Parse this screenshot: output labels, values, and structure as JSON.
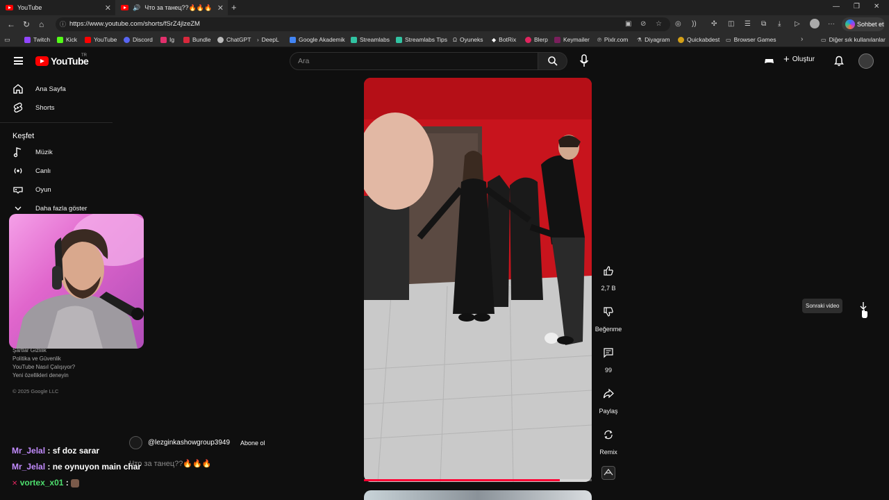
{
  "browser": {
    "tabs": [
      {
        "title": "YouTube",
        "active": false
      },
      {
        "title": "Что за танец??🔥🔥🔥 - Yo",
        "active": true
      }
    ],
    "url": "https://www.youtube.com/shorts/fSrZ4jlzeZM",
    "copilot_label": "Sohbet et",
    "bookmarks": [
      "Twitch",
      "Kick",
      "YouTube",
      "Discord",
      "Ig",
      "Bundle",
      "ChatGPT",
      "DeepL",
      "Google Akademik",
      "Streamlabs",
      "Streamlabs Tips",
      "Oyuneks",
      "BotRix",
      "Blerp",
      "Keymailer",
      "Pixlr.com",
      "Diyagram",
      "Quickabdest",
      "Browser Games"
    ],
    "other_bookmarks": "Diğer sık kullanılanlar"
  },
  "header": {
    "logo_text": "YouTube",
    "region": "TR",
    "search_placeholder": "Ara",
    "create_label": "Oluştur"
  },
  "sidebar": {
    "main": [
      {
        "label": "Ana Sayfa",
        "icon": "home-icon"
      },
      {
        "label": "Shorts",
        "icon": "shorts-icon"
      }
    ],
    "explore_title": "Keşfet",
    "explore": [
      {
        "label": "Müzik",
        "icon": "music-icon"
      },
      {
        "label": "Canlı",
        "icon": "live-icon"
      },
      {
        "label": "Oyun",
        "icon": "gaming-icon"
      }
    ],
    "show_more": "Daha fazla göster",
    "footer": [
      "Şartlar  Gizlilik",
      "Politika ve Güvenlik",
      "YouTube Nasıl Çalışıyor?",
      "Yeni özellikleri deneyin"
    ],
    "copyright": "© 2025 Google LLC"
  },
  "short": {
    "channel": "@lezginkashowgroup3949",
    "subscribe_label": "Abone ol",
    "title": "Что за танец??🔥🔥🔥",
    "progress": 0.86,
    "actions": {
      "like_count": "2,7 B",
      "dislike_label": "Beğenme",
      "comment_count": "99",
      "share_label": "Paylaş",
      "remix_label": "Remix"
    },
    "next_tooltip": "Sonraki video"
  },
  "chat": [
    {
      "user": "Mr_Jelal",
      "message": ": sf doz sarar"
    },
    {
      "user": "Mr_Jelal",
      "message": ": ne oynuyon main char"
    },
    {
      "user": "vortex_x01",
      "message": ":"
    }
  ],
  "colors": {
    "accent": "#ff0000",
    "chat_user_1": "#c38cff",
    "chat_user_2": "#4ee06e"
  }
}
